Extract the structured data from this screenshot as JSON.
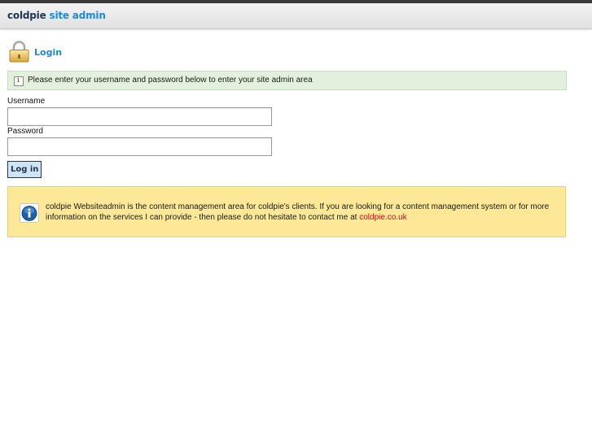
{
  "header": {
    "brand_primary": "coldpie",
    "brand_secondary": "site admin"
  },
  "login": {
    "title": "Login",
    "lock_icon": "padlock-icon"
  },
  "notice": {
    "icon": "info-icon",
    "text": "Please enter your username and password below to enter your site admin area"
  },
  "form": {
    "username_label": "Username",
    "username_value": "",
    "password_label": "Password",
    "password_value": "",
    "submit_label": "Log in"
  },
  "info": {
    "icon": "information-badge-icon",
    "text": "coldpie Websiteadmin is the content management area for coldpie's clients. If you are looking for a content management system or for more information on the services I can provide - then please do not hesitate to contact me at ",
    "link_text": "coldpie.co.uk"
  },
  "colors": {
    "brand_dark": "#1f3550",
    "brand_blue": "#1c8ad6",
    "link_red": "#e5001b",
    "notice_bg": "#e3f0dd",
    "info_bg": "#fde897"
  }
}
